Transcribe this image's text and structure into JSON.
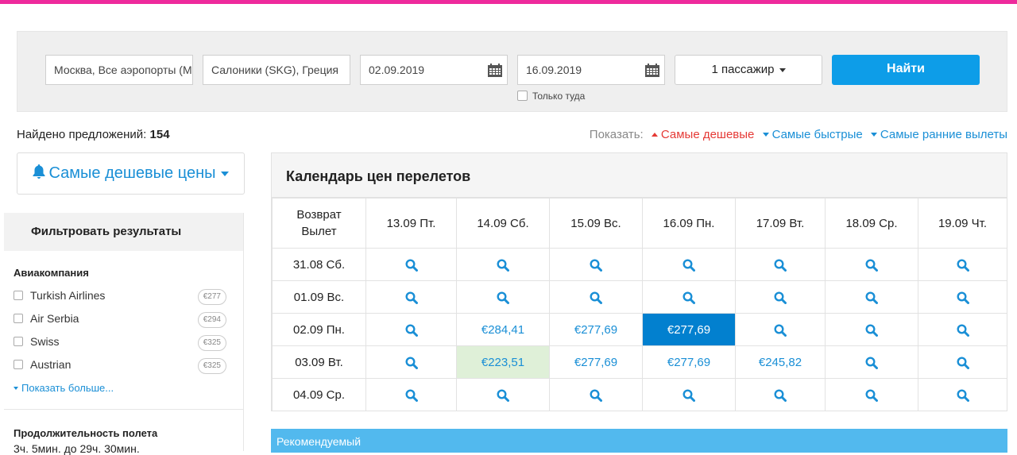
{
  "search": {
    "from": "Москва, Все аэропорты (М",
    "to": "Салоники (SKG), Греция",
    "depart_date": "02.09.2019",
    "return_date": "16.09.2019",
    "passengers": "1 пассажир",
    "find_label": "Найти",
    "oneway_label": "Только туда"
  },
  "results": {
    "found_label": "Найдено предложений:",
    "found_count": "154",
    "show_label": "Показать:",
    "sort_options": [
      "Самые дешевые",
      "Самые быстрые",
      "Самые ранние вылеты"
    ]
  },
  "sidebar": {
    "cheap_prices_label": "Самые дешевые цены",
    "filter_title": "Фильтровать результаты",
    "airline_title": "Авиакомпания",
    "airlines": [
      {
        "name": "Turkish Airlines",
        "price": "€277"
      },
      {
        "name": "Air Serbia",
        "price": "€294"
      },
      {
        "name": "Swiss",
        "price": "€325"
      },
      {
        "name": "Austrian",
        "price": "€325"
      }
    ],
    "show_more": "Показать больше...",
    "duration_title": "Продолжительность полета",
    "duration_value": "3ч. 5мин. до 29ч. 30мин."
  },
  "calendar": {
    "title": "Календарь цен перелетов",
    "corner_return": "Возврат",
    "corner_depart": "Вылет",
    "return_dates": [
      "13.09 Пт.",
      "14.09 Сб.",
      "15.09 Вс.",
      "16.09 Пн.",
      "17.09 Вт.",
      "18.09 Ср.",
      "19.09 Чт."
    ],
    "rows": [
      {
        "date": "31.08 Сб.",
        "cells": [
          "",
          "",
          "",
          "",
          "",
          "",
          ""
        ]
      },
      {
        "date": "01.09 Вс.",
        "cells": [
          "",
          "",
          "",
          "",
          "",
          "",
          ""
        ]
      },
      {
        "date": "02.09 Пн.",
        "cells": [
          "",
          "€284,41",
          "€277,69",
          "€277,69",
          "",
          "",
          ""
        ]
      },
      {
        "date": "03.09 Вт.",
        "cells": [
          "",
          "€223,51",
          "€277,69",
          "€277,69",
          "€245,82",
          "",
          ""
        ]
      },
      {
        "date": "04.09 Ср.",
        "cells": [
          "",
          "",
          "",
          "",
          "",
          "",
          ""
        ]
      }
    ],
    "selected": {
      "row": 2,
      "col": 3
    },
    "cheapest": {
      "row": 3,
      "col": 1
    }
  },
  "recommended_label": "Рекомендуемый",
  "colors": {
    "accent": "#0d9de8",
    "brand_bar": "#ee2a9c",
    "link": "#1a8fd6",
    "active_sort": "#e53935",
    "cheapest_bg": "#dff0d8",
    "selected_bg": "#0280cf"
  }
}
